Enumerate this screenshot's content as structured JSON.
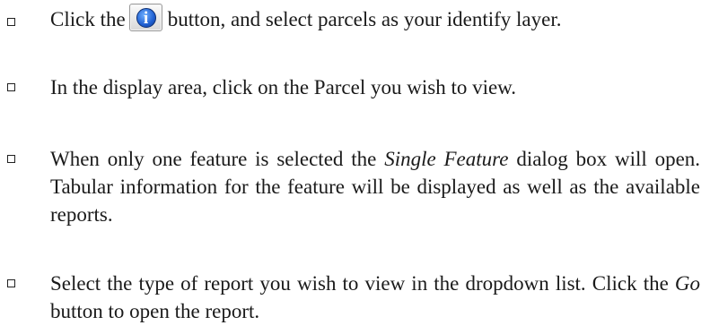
{
  "items": [
    {
      "before": "Click the",
      "icon": "info-icon",
      "icon_glyph": "i",
      "after": "button, and select parcels as your identify layer."
    },
    {
      "text": "In the display area, click on the Parcel you wish to view."
    },
    {
      "before": "When only one feature is selected the",
      "em": "Single Feature",
      "after": "dialog box will open.  Tabular information for the feature will be displayed as well as the available reports."
    },
    {
      "before": "Select the type of report you wish to view in the dropdown list.  Click the",
      "em": "Go",
      "after": "button to open the report."
    }
  ]
}
